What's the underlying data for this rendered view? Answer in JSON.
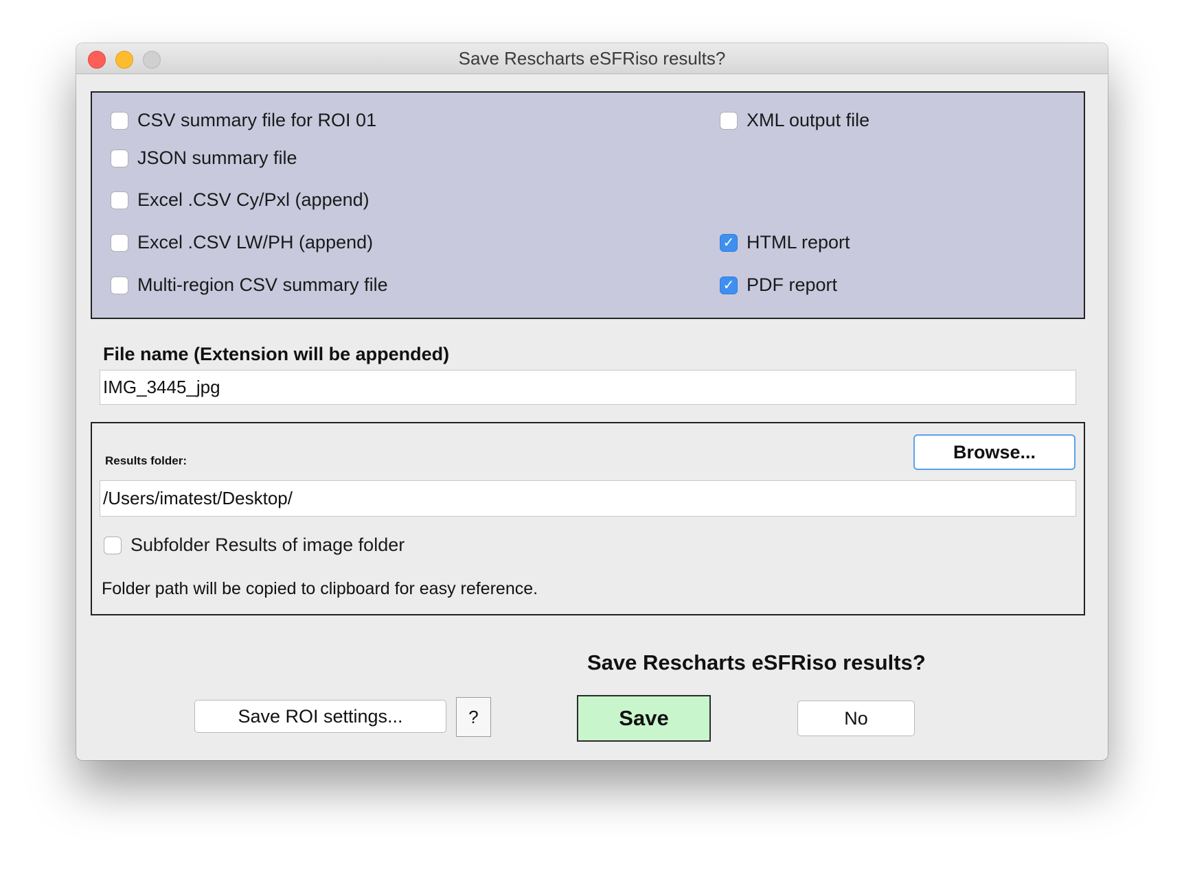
{
  "window": {
    "title": "Save Rescharts eSFRiso results?"
  },
  "options": {
    "csv_summary": {
      "label": "CSV summary file for ROI 01",
      "checked": false
    },
    "json_summary": {
      "label": "JSON summary file",
      "checked": false
    },
    "excel_cy": {
      "label": "Excel .CSV Cy/Pxl (append)",
      "checked": false
    },
    "excel_lw": {
      "label": "Excel .CSV LW/PH (append)",
      "checked": false
    },
    "multi_region": {
      "label": "Multi-region CSV summary file",
      "checked": false
    },
    "xml_output": {
      "label": "XML output file",
      "checked": false
    },
    "html_report": {
      "label": "HTML report",
      "checked": true
    },
    "pdf_report": {
      "label": "PDF report",
      "checked": true
    }
  },
  "file_name": {
    "label": "File name (Extension will be appended)",
    "value": "IMG_3445_jpg"
  },
  "results_folder": {
    "label": "Results folder:",
    "browse_label": "Browse...",
    "path": "/Users/imatest/Desktop/",
    "subfolder_label": "Subfolder Results of image folder",
    "subfolder_checked": false,
    "note": "Folder path will be copied to clipboard for easy reference."
  },
  "footer": {
    "question": "Save Rescharts eSFRiso results?",
    "save_roi_label": "Save ROI settings...",
    "help_label": "?",
    "save_label": "Save",
    "no_label": "No"
  },
  "colors": {
    "options_panel_bg": "#c8c9dd",
    "checkbox_checked": "#3f8ff0",
    "save_button_bg": "#c9f5cc",
    "browse_border": "#5c9ff2"
  }
}
